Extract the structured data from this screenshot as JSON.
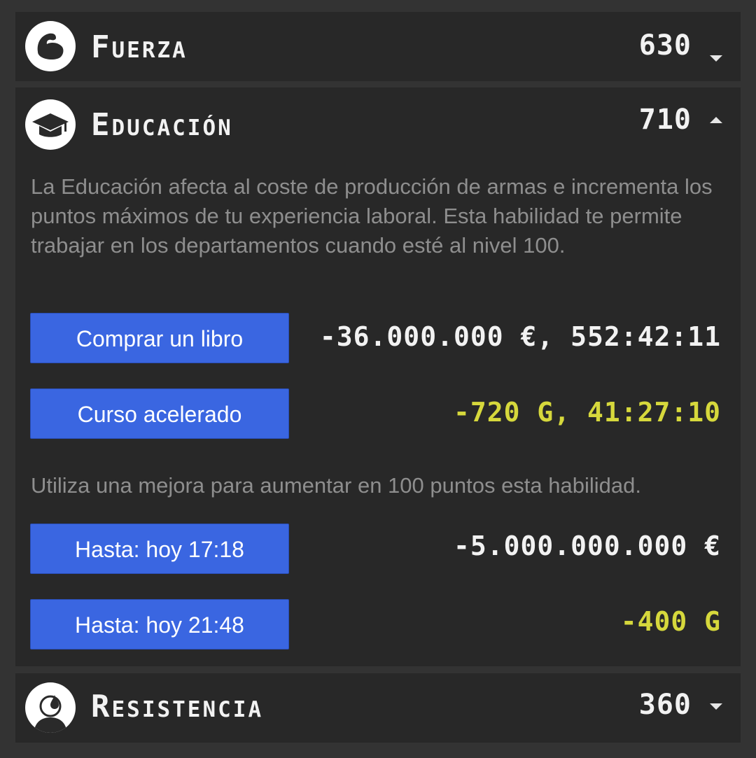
{
  "colors": {
    "page_background": "#333333",
    "panel_background": "#282828",
    "button_blue": "#3a66e1",
    "gold_text": "#d6d83c",
    "description_text": "#8e8e8e",
    "white_text": "#f2f2f2"
  },
  "skills": [
    {
      "name": "Fuerza",
      "value": "630",
      "icon": "bicep-icon",
      "expanded": false
    },
    {
      "name": "Educación",
      "value": "710",
      "icon": "graduation-cap-icon",
      "expanded": true,
      "description": "La Educación afecta al coste de producción de armas e incrementa los puntos máximos de tu experiencia laboral. Esta habilidad te permite trabajar en los departamentos cuando esté al nivel 100.",
      "actions": [
        {
          "label": "Comprar un libro",
          "cost": "-36.000.000 €, 552:42:11",
          "currency": "money"
        },
        {
          "label": "Curso acelerado",
          "cost": "-720 G, 41:27:10",
          "currency": "gold"
        }
      ],
      "boost_text": "Utiliza una mejora para aumentar en 100 puntos esta habilidad.",
      "boosts": [
        {
          "label": "Hasta: hoy 17:18",
          "cost": "-5.000.000.000 €",
          "currency": "money"
        },
        {
          "label": "Hasta: hoy 21:48",
          "cost": "-400 G",
          "currency": "gold"
        }
      ]
    },
    {
      "name": "Resistencia",
      "value": "360",
      "icon": "sweating-person-icon",
      "expanded": false
    }
  ]
}
